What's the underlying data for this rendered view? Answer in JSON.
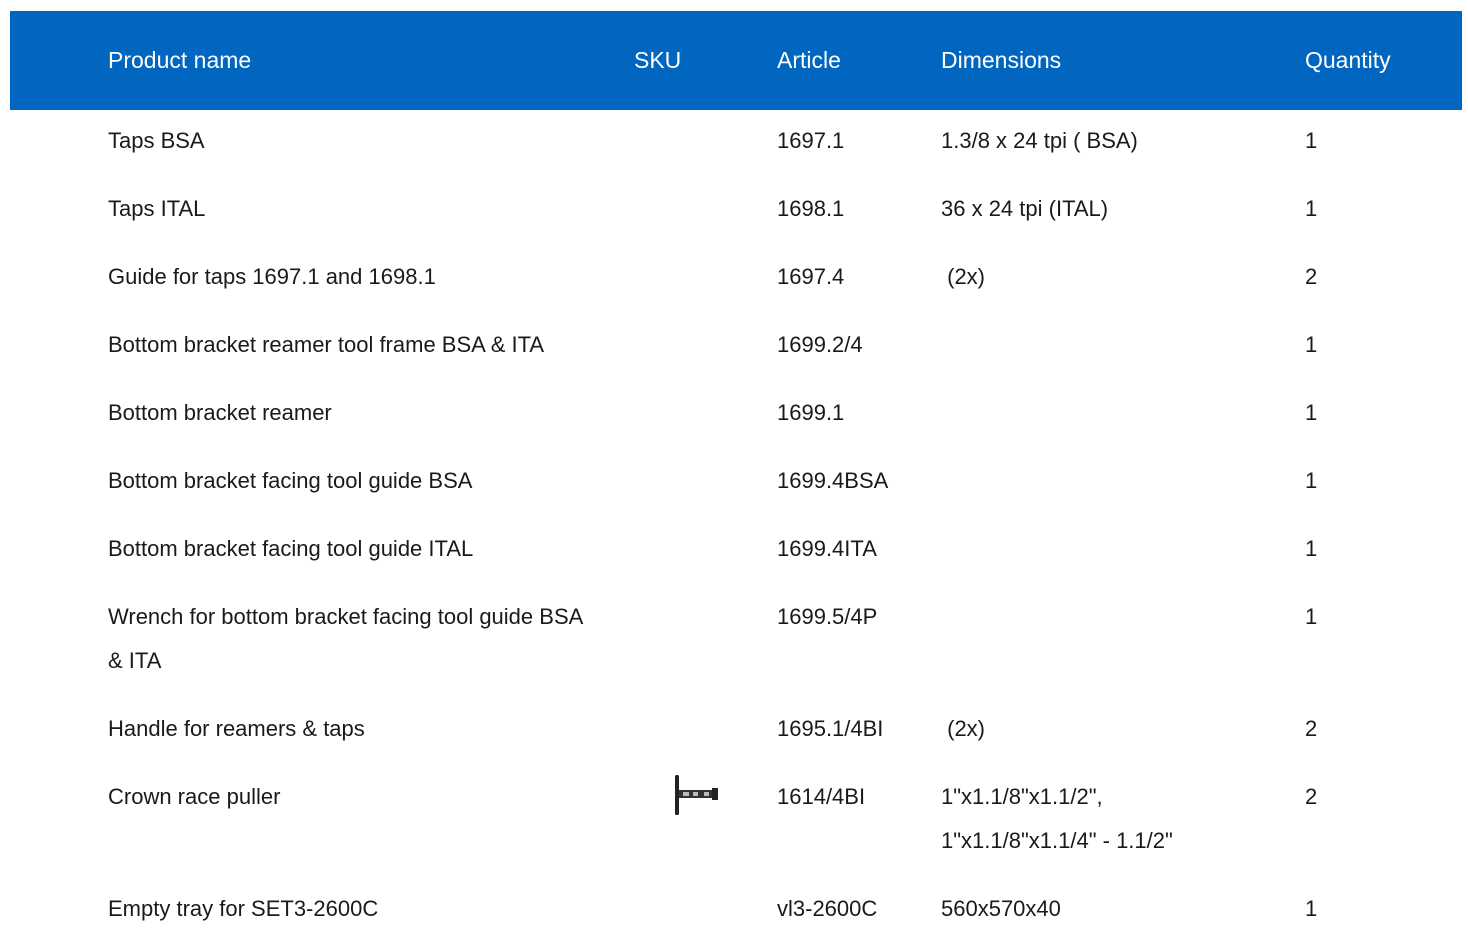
{
  "table": {
    "headers": {
      "product_name": "Product name",
      "sku": "SKU",
      "article": "Article",
      "dimensions": "Dimensions",
      "quantity": "Quantity"
    },
    "rows": [
      {
        "name": "Taps BSA",
        "article": "1697.1",
        "dimensions": [
          "1.3/8 x 24 tpi ( BSA)"
        ],
        "quantity": "1"
      },
      {
        "name": "Taps ITAL",
        "article": "1698.1",
        "dimensions": [
          "36 x 24 tpi (ITAL)"
        ],
        "quantity": "1"
      },
      {
        "name": "Guide for taps 1697.1 and 1698.1",
        "article": "1697.4",
        "dimensions": [
          " (2x)"
        ],
        "quantity": "2"
      },
      {
        "name": "Bottom bracket reamer tool frame BSA & ITA",
        "article": "1699.2/4",
        "dimensions": [],
        "quantity": "1"
      },
      {
        "name": "Bottom bracket reamer",
        "article": "1699.1",
        "dimensions": [],
        "quantity": "1"
      },
      {
        "name": "Bottom bracket facing tool guide BSA",
        "article": "1699.4BSA",
        "dimensions": [],
        "quantity": "1"
      },
      {
        "name": "Bottom bracket facing tool guide ITAL",
        "article": "1699.4ITA",
        "dimensions": [],
        "quantity": "1"
      },
      {
        "name": "Wrench for bottom bracket facing tool guide BSA & ITA",
        "article": "1699.5/4P",
        "dimensions": [],
        "quantity": "1"
      },
      {
        "name": "Handle for reamers & taps",
        "article": "1695.1/4BI",
        "dimensions": [
          " (2x)"
        ],
        "quantity": "2"
      },
      {
        "name": "Crown race puller",
        "sku_icon": "crown-race-puller-icon",
        "article": "1614/4BI",
        "dimensions": [
          "1\"x1.1/8\"x1.1/2\",",
          "1\"x1.1/8\"x1.1/4\" - 1.1/2\""
        ],
        "quantity": "2"
      },
      {
        "name": "Empty tray for SET3-2600C",
        "article": "vl3-2600C",
        "dimensions": [
          "560x570x40"
        ],
        "quantity": "1"
      }
    ]
  },
  "colors": {
    "header_bg": "#0066bf",
    "header_text": "#ffffff",
    "body_text": "#1a1a1a"
  }
}
